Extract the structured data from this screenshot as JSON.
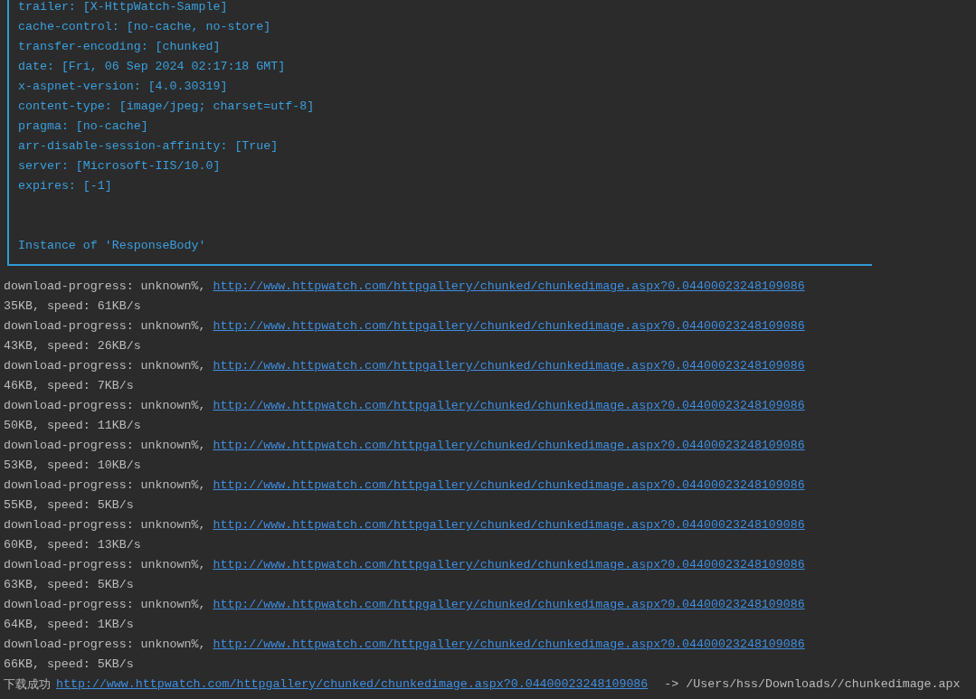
{
  "response_box": {
    "headers": [
      "trailer: [X-HttpWatch-Sample]",
      "cache-control: [no-cache, no-store]",
      "transfer-encoding: [chunked]",
      "date: [Fri, 06 Sep 2024 02:17:18 GMT]",
      "x-aspnet-version: [4.0.30319]",
      "content-type: [image/jpeg; charset=utf-8]",
      "pragma: [no-cache]",
      "arr-disable-session-affinity: [True]",
      "server: [Microsoft-IIS/10.0]",
      "expires: [-1]"
    ],
    "body": "Instance of 'ResponseBody'"
  },
  "log": [
    {
      "kind": "progress",
      "text": "download-progress: unknown%,",
      "url": "http://www.httpwatch.com/httpgallery/chunked/chunkedimage.aspx?0.04400023248109086"
    },
    {
      "kind": "size",
      "text": "35KB, speed: 61KB/s"
    },
    {
      "kind": "progress",
      "text": "download-progress: unknown%,",
      "url": "http://www.httpwatch.com/httpgallery/chunked/chunkedimage.aspx?0.04400023248109086"
    },
    {
      "kind": "size",
      "text": "43KB, speed: 26KB/s"
    },
    {
      "kind": "progress",
      "text": "download-progress: unknown%,",
      "url": "http://www.httpwatch.com/httpgallery/chunked/chunkedimage.aspx?0.04400023248109086"
    },
    {
      "kind": "size",
      "text": "46KB, speed: 7KB/s"
    },
    {
      "kind": "progress",
      "text": "download-progress: unknown%,",
      "url": "http://www.httpwatch.com/httpgallery/chunked/chunkedimage.aspx?0.04400023248109086"
    },
    {
      "kind": "size",
      "text": "50KB, speed: 11KB/s"
    },
    {
      "kind": "progress",
      "text": "download-progress: unknown%,",
      "url": "http://www.httpwatch.com/httpgallery/chunked/chunkedimage.aspx?0.04400023248109086"
    },
    {
      "kind": "size",
      "text": "53KB, speed: 10KB/s"
    },
    {
      "kind": "progress",
      "text": "download-progress: unknown%,",
      "url": "http://www.httpwatch.com/httpgallery/chunked/chunkedimage.aspx?0.04400023248109086"
    },
    {
      "kind": "size",
      "text": "55KB, speed: 5KB/s"
    },
    {
      "kind": "progress",
      "text": "download-progress: unknown%,",
      "url": "http://www.httpwatch.com/httpgallery/chunked/chunkedimage.aspx?0.04400023248109086"
    },
    {
      "kind": "size",
      "text": "60KB, speed: 13KB/s"
    },
    {
      "kind": "progress",
      "text": "download-progress: unknown%,",
      "url": "http://www.httpwatch.com/httpgallery/chunked/chunkedimage.aspx?0.04400023248109086"
    },
    {
      "kind": "size",
      "text": "63KB, speed: 5KB/s"
    },
    {
      "kind": "progress",
      "text": "download-progress: unknown%,",
      "url": "http://www.httpwatch.com/httpgallery/chunked/chunkedimage.aspx?0.04400023248109086"
    },
    {
      "kind": "size",
      "text": "64KB, speed: 1KB/s"
    },
    {
      "kind": "progress",
      "text": "download-progress: unknown%,",
      "url": "http://www.httpwatch.com/httpgallery/chunked/chunkedimage.aspx?0.04400023248109086"
    },
    {
      "kind": "size",
      "text": "66KB, speed: 5KB/s"
    },
    {
      "kind": "done",
      "text": "下载成功",
      "url": "http://www.httpwatch.com/httpgallery/chunked/chunkedimage.aspx?0.04400023248109086",
      "suffix": "-> /Users/hss/Downloads//chunkedimage.apx"
    }
  ]
}
